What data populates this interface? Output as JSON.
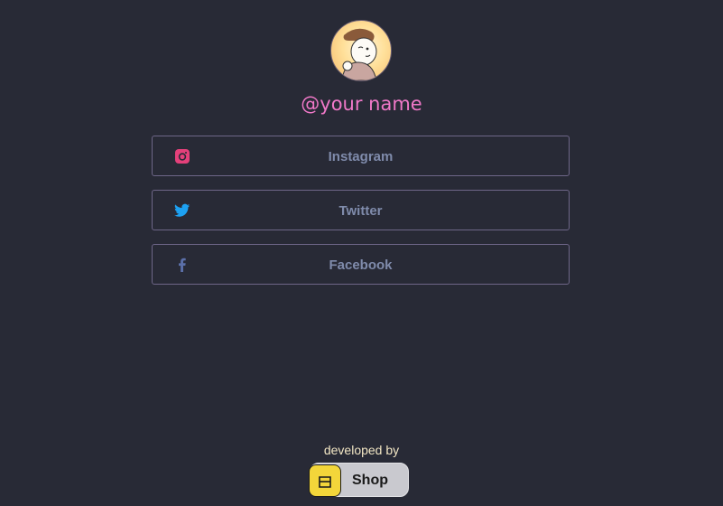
{
  "profile": {
    "username": "@your name"
  },
  "links": [
    {
      "label": "Instagram",
      "icon": "instagram-icon",
      "icon_color": "#e4407a"
    },
    {
      "label": "Twitter",
      "icon": "twitter-icon",
      "icon_color": "#1da1f2"
    },
    {
      "label": "Facebook",
      "icon": "facebook-icon",
      "icon_color": "#5b6fa8"
    }
  ],
  "footer": {
    "developed_by": "developed by",
    "shop_label": "Shop",
    "shop_logo": "shop-bag-icon"
  },
  "colors": {
    "background": "#282a36",
    "username": "#f078c8",
    "button_border": "#6e6688",
    "button_text": "#8f9cc0",
    "footer_text": "#f2e6c4"
  }
}
